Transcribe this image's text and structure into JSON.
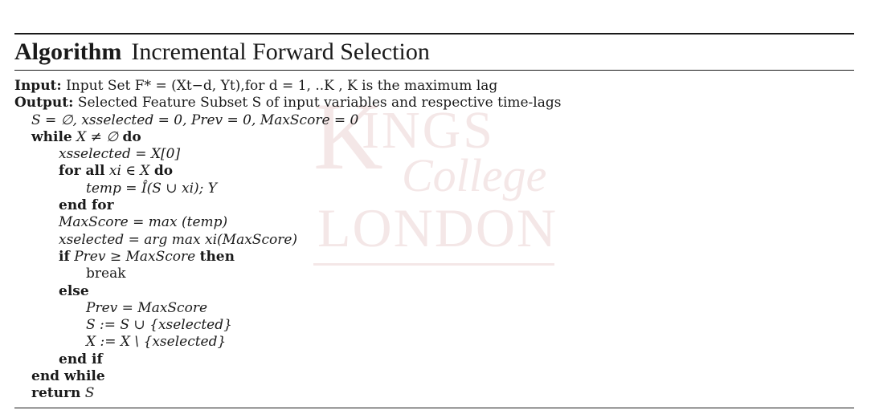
{
  "watermark": {
    "l1": "K",
    "l2": "INGS",
    "l3": "College",
    "l4": "LONDON"
  },
  "algorithm": {
    "label": "Algorithm",
    "name": "Incremental Forward Selection",
    "input_label": "Input:",
    "input_text": "Input Set F* = (Xt−d, Yt),for d = 1, ..K , K is the maximum lag",
    "output_label": "Output:",
    "output_text": "Selected Feature Subset S of input variables and respective time-lags",
    "init": "S = ∅, xsselected = 0, Prev = 0, MaxScore = 0",
    "while_kw": "while",
    "while_cond": "X ≠ ∅",
    "do_kw": "do",
    "assign1": "xsselected = X[0]",
    "for_kw": "for all",
    "for_cond": "xi ∈ X",
    "temp": "temp = Î(S ∪ xi); Y",
    "end_for": "end for",
    "maxscore": "MaxScore = max (temp)",
    "xselected": "xselected = arg max xi(MaxScore)",
    "if_kw": "if",
    "if_cond": "Prev ≥ MaxScore",
    "then_kw": "then",
    "break": "break",
    "else_kw": "else",
    "prev_assign": "Prev = MaxScore",
    "s_assign": "S := S ∪ {xselected}",
    "x_assign": "X := X \\ {xselected}",
    "end_if": "end if",
    "end_while": "end while",
    "return_kw": "return",
    "return_val": "S"
  }
}
